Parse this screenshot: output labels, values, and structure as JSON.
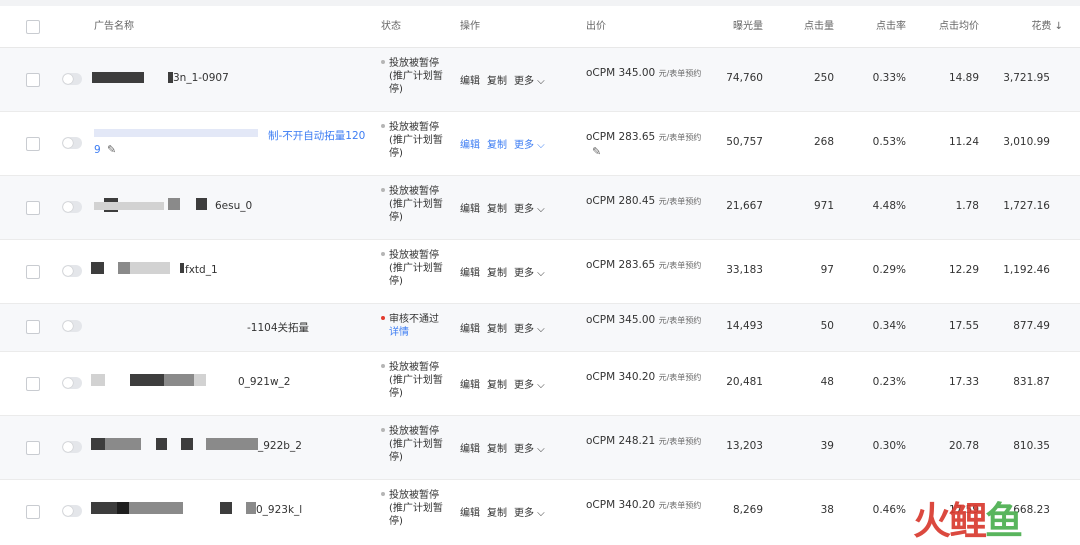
{
  "header": {
    "name": "广告名称",
    "status": "状态",
    "ops": "操作",
    "bid": "出价",
    "impressions": "曝光量",
    "clicks": "点击量",
    "ctr": "点击率",
    "cpc": "点击均价",
    "cost": "花费 ↓"
  },
  "rows": [
    {
      "name": "3n_1-0907",
      "status_l1": "投放被暂停",
      "status_l2": "(推广计划暂",
      "status_l3": "停)",
      "edit": "编辑",
      "copy": "复制",
      "more": "更多 ⌵",
      "bid": "oCPM  345.00",
      "unit": "元/表单预约",
      "imp": "74,760",
      "clk": "250",
      "ctr": "0.33%",
      "cpc": "14.89",
      "cost": "3,721.95"
    },
    {
      "name_l1": "制-不开自动拓量120",
      "name_l2": "9",
      "status_l1": "投放被暂停",
      "status_l2": "(推广计划暂",
      "status_l3": "停)",
      "edit": "编辑",
      "copy": "复制",
      "more": "更多 ⌵",
      "bid": "oCPM  283.65",
      "unit": "元/表单预约",
      "imp": "50,757",
      "clk": "268",
      "ctr": "0.53%",
      "cpc": "11.24",
      "cost": "3,010.99"
    },
    {
      "name": "6esu_0",
      "status_l1": "投放被暂停",
      "status_l2": "(推广计划暂",
      "status_l3": "停)",
      "edit": "编辑",
      "copy": "复制",
      "more": "更多 ⌵",
      "bid": "oCPM  280.45",
      "unit": "元/表单预约",
      "imp": "21,667",
      "clk": "971",
      "ctr": "4.48%",
      "cpc": "1.78",
      "cost": "1,727.16"
    },
    {
      "name": "fxtd_1",
      "status_l1": "投放被暂停",
      "status_l2": "(推广计划暂",
      "status_l3": "停)",
      "edit": "编辑",
      "copy": "复制",
      "more": "更多 ⌵",
      "bid": "oCPM  283.65",
      "unit": "元/表单预约",
      "imp": "33,183",
      "clk": "97",
      "ctr": "0.29%",
      "cpc": "12.29",
      "cost": "1,192.46"
    },
    {
      "name": "-1104关拓量",
      "status_l1": "审核不通过",
      "status_l2": "详情",
      "edit": "编辑",
      "copy": "复制",
      "more": "更多 ⌵",
      "bid": "oCPM  345.00",
      "unit": "元/表单预约",
      "imp": "14,493",
      "clk": "50",
      "ctr": "0.34%",
      "cpc": "17.55",
      "cost": "877.49"
    },
    {
      "name": "0_921w_2",
      "status_l1": "投放被暂停",
      "status_l2": "(推广计划暂",
      "status_l3": "停)",
      "edit": "编辑",
      "copy": "复制",
      "more": "更多 ⌵",
      "bid": "oCPM  340.20",
      "unit": "元/表单预约",
      "imp": "20,481",
      "clk": "48",
      "ctr": "0.23%",
      "cpc": "17.33",
      "cost": "831.87"
    },
    {
      "name": "_922b_2",
      "status_l1": "投放被暂停",
      "status_l2": "(推广计划暂",
      "status_l3": "停)",
      "edit": "编辑",
      "copy": "复制",
      "more": "更多 ⌵",
      "bid": "oCPM  248.21",
      "unit": "元/表单预约",
      "imp": "13,203",
      "clk": "39",
      "ctr": "0.30%",
      "cpc": "20.78",
      "cost": "810.35"
    },
    {
      "name": "0_923k_l",
      "status_l1": "投放被暂停",
      "status_l2": "(推广计划暂",
      "status_l3": "停)",
      "edit": "编辑",
      "copy": "复制",
      "more": "更多 ⌵",
      "bid": "oCPM  340.20",
      "unit": "元/表单预约",
      "imp": "8,269",
      "clk": "38",
      "ctr": "0.46%",
      "cpc": "17.59",
      "cost": "668.23"
    }
  ],
  "watermark": {
    "a": "火",
    "b": "鲤",
    "c": "鱼"
  }
}
